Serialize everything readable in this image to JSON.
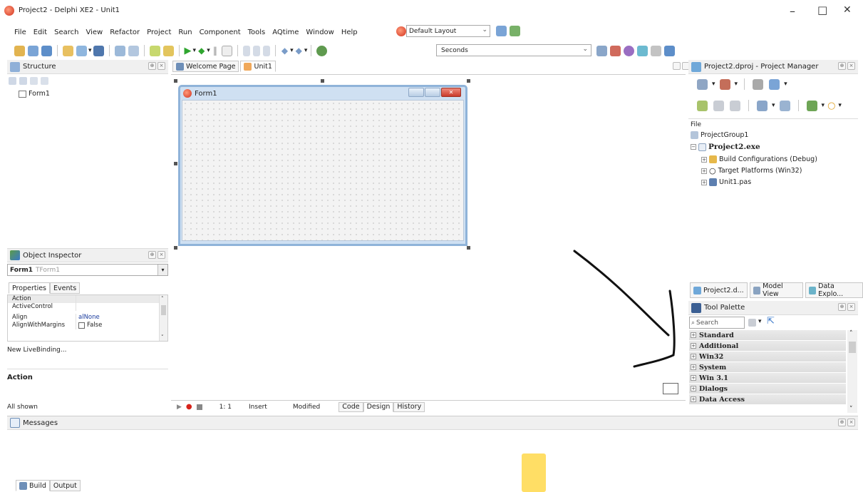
{
  "window": {
    "title": "Project2 - Delphi XE2 - Unit1",
    "controls": {
      "minimize": "–",
      "maximize": "□",
      "close": "✕"
    }
  },
  "menu": {
    "items": [
      "File",
      "Edit",
      "Search",
      "View",
      "Refactor",
      "Project",
      "Run",
      "Component",
      "Tools",
      "AQtime",
      "Window",
      "Help"
    ],
    "layout_select": "Default Layout"
  },
  "toolbar": {
    "speed_select": "Seconds"
  },
  "structure": {
    "title": "Structure",
    "tree_item": "Form1"
  },
  "editor": {
    "tabs": [
      "Welcome Page",
      "Unit1"
    ],
    "form_caption": "Form1",
    "status": {
      "position": "1:  1",
      "mode": "Insert",
      "state": "Modified"
    },
    "view_tabs": [
      "Code",
      "Design",
      "History"
    ]
  },
  "object_inspector": {
    "title": "Object Inspector",
    "selected_name": "Form1",
    "selected_type": "TForm1",
    "tabs": [
      "Properties",
      "Events"
    ],
    "rows": [
      {
        "key": "Action",
        "value": ""
      },
      {
        "key": "ActiveControl",
        "value": ""
      },
      {
        "key": "Align",
        "value": "alNone"
      },
      {
        "key": "AlignWithMargins",
        "value": "False"
      }
    ],
    "livebinding": "New LiveBinding...",
    "description_title": "Action",
    "footer": "All shown"
  },
  "project_manager": {
    "title": "Project2.dproj - Project Manager",
    "column": "File",
    "tree": {
      "group": "ProjectGroup1",
      "project": "Project2.exe",
      "build": "Build Configurations (Debug)",
      "platforms": "Target Platforms (Win32)",
      "unit": "Unit1.pas"
    },
    "tabs": [
      "Project2.d...",
      "Model View",
      "Data Explo..."
    ]
  },
  "tool_palette": {
    "title": "Tool Palette",
    "search_placeholder": "Search",
    "categories": [
      "Standard",
      "Additional",
      "Win32",
      "System",
      "Win 3.1",
      "Dialogs",
      "Data Access"
    ]
  },
  "messages": {
    "title": "Messages",
    "tabs": [
      "Build",
      "Output"
    ]
  },
  "colors": {
    "accent_blue": "#3a78c9",
    "form_border": "#8fb3d9",
    "close_red": "#d9473a"
  }
}
